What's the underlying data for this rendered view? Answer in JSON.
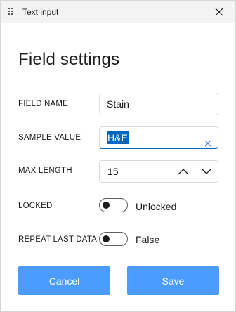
{
  "window": {
    "title": "Text input",
    "icon": "app-grid-icon",
    "close_icon": "close-icon"
  },
  "heading": "Field settings",
  "fields": {
    "field_name": {
      "label": "FIELD NAME",
      "value": "Stain"
    },
    "sample_value": {
      "label": "SAMPLE VALUE",
      "value": "H&E",
      "selected": true,
      "clear_icon": "clear-icon"
    },
    "max_length": {
      "label": "MAX LENGTH",
      "value": "15",
      "up_icon": "chevron-up-icon",
      "down_icon": "chevron-down-icon"
    },
    "locked": {
      "label": "LOCKED",
      "state_text": "Unlocked",
      "on": false
    },
    "repeat_last_data": {
      "label": "REPEAT LAST DATA",
      "state_text": "False",
      "on": false
    }
  },
  "buttons": {
    "cancel": "Cancel",
    "save": "Save"
  },
  "colors": {
    "accent": "#0067c0",
    "button": "#4c9bff"
  }
}
